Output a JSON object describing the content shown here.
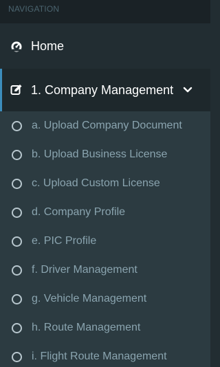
{
  "sidebar": {
    "header": "NAVIGATION",
    "home_label": "Home",
    "company_label": "1. Company Management",
    "submenu": [
      "a. Upload Company Document",
      "b. Upload Business License",
      "c. Upload Custom License",
      "d. Company Profile",
      "e. PIC Profile",
      "f. Driver Management",
      "g. Vehicle Management",
      "h. Route Management",
      "i. Flight Route Management"
    ]
  },
  "colors": {
    "sidebar_bg": "#222d32",
    "submenu_bg": "#2c3b41",
    "active_accent": "#3c8dbc",
    "submenu_text": "#8aa4af"
  },
  "icons": {
    "home": "dashboard-icon",
    "company": "edit-icon",
    "submenu": "circle-icon",
    "expand": "chevron-down-icon"
  }
}
